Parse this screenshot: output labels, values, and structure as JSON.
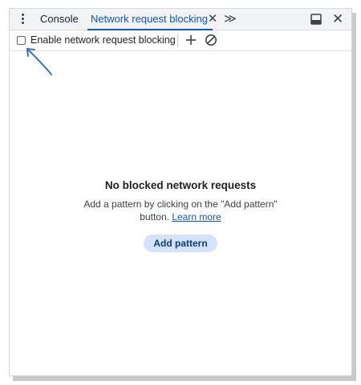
{
  "tabs": {
    "more_options_icon": "kebab-vertical-icon",
    "console_label": "Console",
    "network_label": "Network request blocking",
    "close_tab_glyph": "✕",
    "more_tabs_glyph": "≫",
    "dock_icon": "dock-side-icon",
    "close_panel_glyph": "✕"
  },
  "toolbar": {
    "enable_label": "Enable network request blocking",
    "enable_checked": false,
    "add_icon": "plus-icon",
    "block_icon": "block-icon"
  },
  "empty_state": {
    "title": "No blocked network requests",
    "description": "Add a pattern by clicking on the \"Add pattern\" button.",
    "learn_more": "Learn more",
    "button_label": "Add pattern"
  },
  "colors": {
    "accent": "#0b57d0",
    "button_bg": "#d3e3fd",
    "annotation": "#3a73c7"
  }
}
